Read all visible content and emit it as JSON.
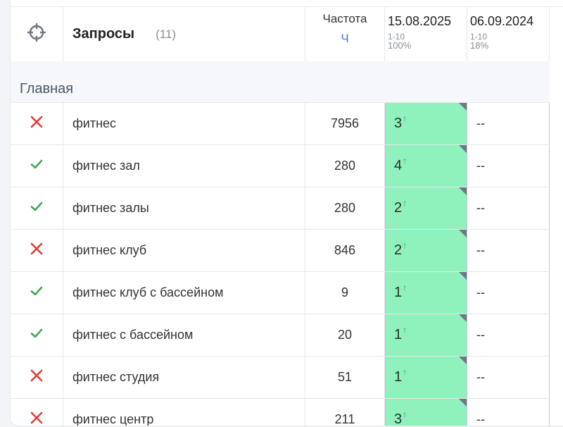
{
  "header": {
    "title": "Запросы",
    "count": "(11)",
    "freq_label": "Частота",
    "freq_sub": "Ч",
    "dates": [
      {
        "date": "15.08.2025",
        "range": "1-10",
        "percent": "100%"
      },
      {
        "date": "06.09.2024",
        "range": "1-10",
        "percent": "18%"
      }
    ]
  },
  "group": {
    "name": "Главная"
  },
  "rows": [
    {
      "status": "cross",
      "query": "фитнес",
      "freq": "7956",
      "pos1": "3",
      "pos2": "--"
    },
    {
      "status": "check",
      "query": "фитнес зал",
      "freq": "280",
      "pos1": "4",
      "pos2": "--"
    },
    {
      "status": "check",
      "query": "фитнес залы",
      "freq": "280",
      "pos1": "2",
      "pos2": "--"
    },
    {
      "status": "cross",
      "query": "фитнес клуб",
      "freq": "846",
      "pos1": "2",
      "pos2": "--"
    },
    {
      "status": "check",
      "query": "фитнес клуб с бассейном",
      "freq": "9",
      "pos1": "1",
      "pos2": "--"
    },
    {
      "status": "check",
      "query": "фитнес с бассейном",
      "freq": "20",
      "pos1": "1",
      "pos2": "--"
    },
    {
      "status": "cross",
      "query": "фитнес студия",
      "freq": "51",
      "pos1": "1",
      "pos2": "--"
    },
    {
      "status": "cross",
      "query": "фитнес центр",
      "freq": "211",
      "pos1": "3",
      "pos2": "--"
    }
  ],
  "colors": {
    "cross": "#e53935",
    "check": "#3fa65a",
    "position_bg": "#8ff2bd",
    "accent": "#3b7ddd"
  },
  "icons": {
    "target": "crosshair-icon",
    "up": "arrow-up-icon"
  },
  "up_arrow": "↑"
}
